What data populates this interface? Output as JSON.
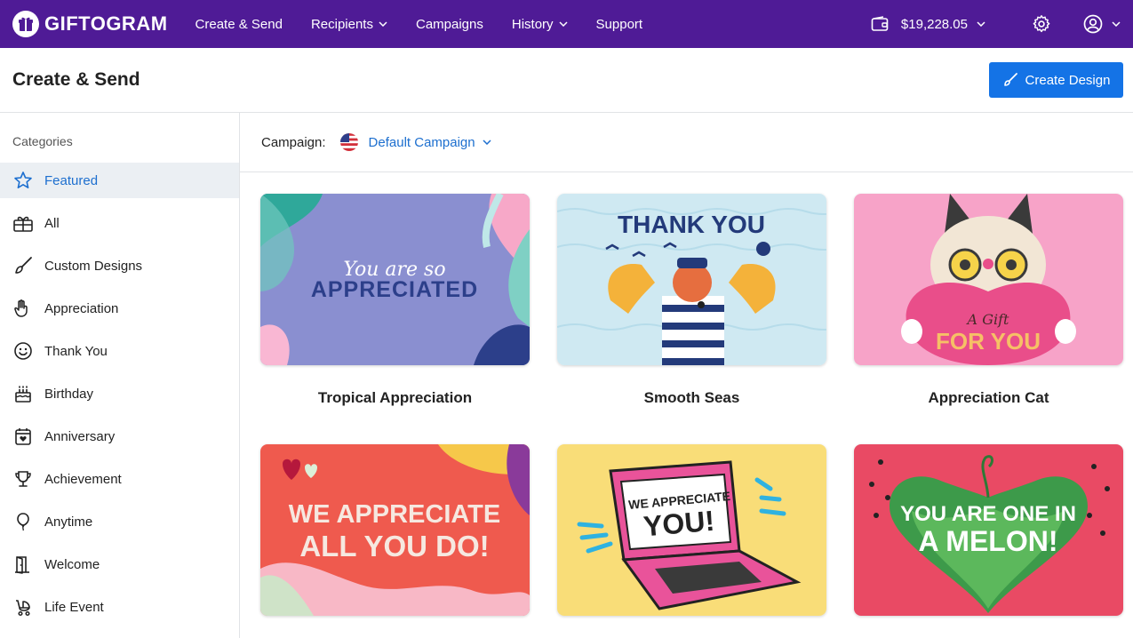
{
  "brand": {
    "name": "GIFTOGRAM"
  },
  "nav": {
    "items": [
      {
        "label": "Create & Send",
        "dropdown": false
      },
      {
        "label": "Recipients",
        "dropdown": true
      },
      {
        "label": "Campaigns",
        "dropdown": false
      },
      {
        "label": "History",
        "dropdown": true
      },
      {
        "label": "Support",
        "dropdown": false
      }
    ],
    "balance": "$19,228.05"
  },
  "page": {
    "title": "Create & Send",
    "create_button": "Create Design"
  },
  "sidebar": {
    "heading": "Categories",
    "items": [
      {
        "label": "Featured",
        "icon": "star-icon",
        "active": true
      },
      {
        "label": "All",
        "icon": "gift-box-icon"
      },
      {
        "label": "Custom Designs",
        "icon": "paintbrush-icon"
      },
      {
        "label": "Appreciation",
        "icon": "hand-icon"
      },
      {
        "label": "Thank You",
        "icon": "smiley-icon"
      },
      {
        "label": "Birthday",
        "icon": "cake-icon"
      },
      {
        "label": "Anniversary",
        "icon": "calendar-heart-icon"
      },
      {
        "label": "Achievement",
        "icon": "trophy-icon"
      },
      {
        "label": "Anytime",
        "icon": "balloon-icon"
      },
      {
        "label": "Welcome",
        "icon": "door-icon"
      },
      {
        "label": "Life Event",
        "icon": "stroller-icon"
      }
    ]
  },
  "campaign": {
    "label": "Campaign:",
    "selected": "Default Campaign"
  },
  "cards": [
    {
      "title": "Tropical Appreciation",
      "art_small": "You are so",
      "art_big": "APPRECIATED"
    },
    {
      "title": "Smooth Seas",
      "art_big": "THANK YOU"
    },
    {
      "title": "Appreciation Cat",
      "art_small": "A Gift",
      "art_big": "FOR YOU"
    },
    {
      "title": "",
      "art_line1": "WE APPRECIATE",
      "art_line2": "ALL YOU DO!"
    },
    {
      "title": "",
      "art_line1": "WE APPRECIATE",
      "art_line2": "YOU!"
    },
    {
      "title": "",
      "art_line1": "YOU ARE ONE IN",
      "art_line2": "A MELON!"
    }
  ],
  "colors": {
    "nav_bg": "#4f1b96",
    "accent": "#1473e6",
    "link": "#1d6fcf"
  }
}
